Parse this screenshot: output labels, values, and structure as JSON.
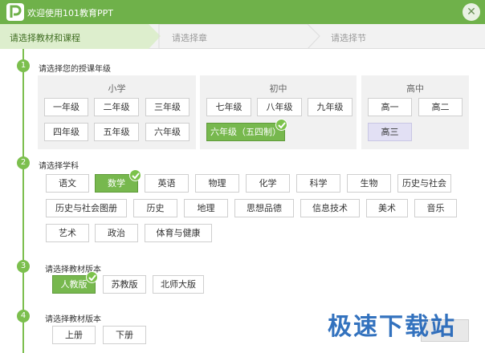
{
  "window": {
    "title": "欢迎使用101教育PPT"
  },
  "steps": [
    "请选择教材和课程",
    "请选择章",
    "请选择节"
  ],
  "section1": {
    "num": "1",
    "title": "请选择您的授课年级",
    "panels": [
      {
        "title": "小学",
        "grades": [
          "一年级",
          "二年级",
          "三年级",
          "四年级",
          "五年级",
          "六年级"
        ]
      },
      {
        "title": "初中",
        "grades": [
          "七年级",
          "八年级",
          "九年级",
          "六年级（五四制）"
        ],
        "selected": "六年级（五四制）"
      },
      {
        "title": "高中",
        "grades": [
          "高一",
          "高二",
          "高三"
        ],
        "highlighted": "高三"
      }
    ]
  },
  "section2": {
    "num": "2",
    "title": "请选择学科",
    "row1": [
      "语文",
      "数学",
      "英语",
      "物理",
      "化学",
      "科学",
      "生物",
      "历史与社会"
    ],
    "row2": [
      "历史与社会图册",
      "历史",
      "地理",
      "思想品德",
      "信息技术",
      "美术",
      "音乐"
    ],
    "row3": [
      "艺术",
      "政治",
      "体育与健康"
    ],
    "selected": "数学"
  },
  "section3": {
    "num": "3",
    "title": "请选择教材版本",
    "options": [
      "人教版",
      "苏教版",
      "北师大版"
    ],
    "selected": "人教版"
  },
  "section4": {
    "num": "4",
    "title": "请选择教材版本",
    "options": [
      "上册",
      "下册"
    ]
  },
  "watermark": "极速下载站",
  "colors": {
    "accent": "#6fb14a",
    "selected": "#77b84e",
    "highlight": "#e2e0f4"
  }
}
